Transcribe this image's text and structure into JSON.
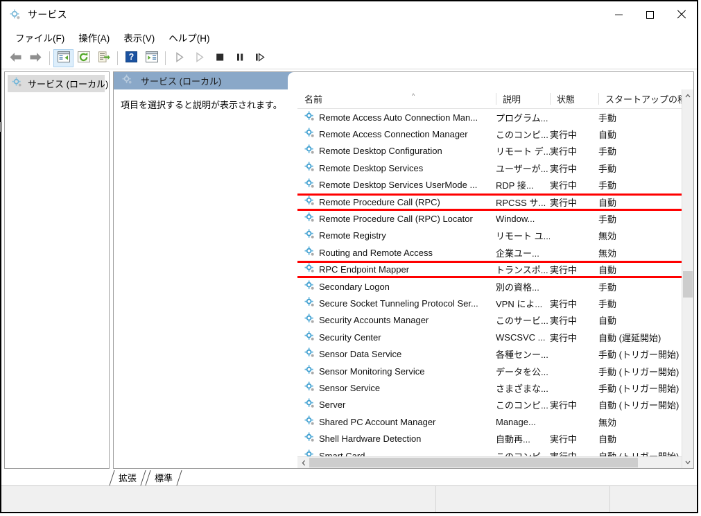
{
  "window": {
    "title": "サービス",
    "title_icon": "services-gear-icon",
    "controls": {
      "minimize": "minimize-button",
      "maximize": "maximize-button",
      "close": "close-button"
    }
  },
  "menubar": {
    "items": [
      {
        "label": "ファイル(F)",
        "name": "menu-file"
      },
      {
        "label": "操作(A)",
        "name": "menu-action"
      },
      {
        "label": "表示(V)",
        "name": "menu-view"
      },
      {
        "label": "ヘルプ(H)",
        "name": "menu-help"
      }
    ]
  },
  "toolbar": {
    "buttons": [
      {
        "name": "back-button",
        "icon": "arrow-left-icon",
        "enabled": true
      },
      {
        "name": "forward-button",
        "icon": "arrow-right-icon",
        "enabled": true
      },
      {
        "name": "show-hide-tree-button",
        "icon": "console-tree-icon",
        "active": true
      },
      {
        "name": "refresh-button",
        "icon": "refresh-icon",
        "enabled": true
      },
      {
        "name": "export-list-button",
        "icon": "export-list-icon",
        "enabled": true
      },
      {
        "name": "help-button",
        "icon": "question-mark-icon",
        "enabled": true
      },
      {
        "name": "show-action-pane-button",
        "icon": "action-pane-icon",
        "enabled": true
      },
      {
        "name": "start-service-button",
        "icon": "play-icon",
        "enabled": false
      },
      {
        "name": "restart-service-button",
        "icon": "play-outline-icon",
        "enabled": false
      },
      {
        "name": "stop-service-button",
        "icon": "stop-square-icon",
        "enabled": true
      },
      {
        "name": "pause-service-button",
        "icon": "pause-icon",
        "enabled": true
      },
      {
        "name": "resume-service-button",
        "icon": "step-forward-icon",
        "enabled": true
      }
    ]
  },
  "tree": {
    "node_label": "サービス (ローカル)",
    "node_icon": "services-gear-icon"
  },
  "pane": {
    "header_label": "サービス (ローカル)",
    "header_icon": "services-gear-icon",
    "header_color": "#8aa8c8",
    "description_placeholder": "項目を選択すると説明が表示されます。"
  },
  "list": {
    "columns": [
      {
        "label": "名前",
        "name": "column-header-name",
        "sorted": true
      },
      {
        "label": "説明",
        "name": "column-header-description",
        "sorted": false
      },
      {
        "label": "状態",
        "name": "column-header-status",
        "sorted": false
      },
      {
        "label": "スタートアップの種類",
        "name": "column-header-startup-type",
        "sorted": true
      }
    ],
    "rows": [
      {
        "name": "Remote Access Auto Connection Man...",
        "description": "プログラム...",
        "status": "",
        "startup": "手動",
        "highlighted": false
      },
      {
        "name": "Remote Access Connection Manager",
        "description": "このコンピ...",
        "status": "実行中",
        "startup": "自動",
        "highlighted": false
      },
      {
        "name": "Remote Desktop Configuration",
        "description": "リモート デ...",
        "status": "実行中",
        "startup": "手動",
        "highlighted": false
      },
      {
        "name": "Remote Desktop Services",
        "description": "ユーザーが...",
        "status": "実行中",
        "startup": "手動",
        "highlighted": false
      },
      {
        "name": "Remote Desktop Services UserMode ...",
        "description": "RDP 接...",
        "status": "実行中",
        "startup": "手動",
        "highlighted": false
      },
      {
        "name": "Remote Procedure Call (RPC)",
        "description": "RPCSS サ...",
        "status": "実行中",
        "startup": "自動",
        "highlighted": true
      },
      {
        "name": "Remote Procedure Call (RPC) Locator",
        "description": "Window...",
        "status": "",
        "startup": "手動",
        "highlighted": false
      },
      {
        "name": "Remote Registry",
        "description": "リモート ユ...",
        "status": "",
        "startup": "無効",
        "highlighted": false
      },
      {
        "name": "Routing and Remote Access",
        "description": "企業ユー...",
        "status": "",
        "startup": "無効",
        "highlighted": false
      },
      {
        "name": "RPC Endpoint Mapper",
        "description": "トランスポ...",
        "status": "実行中",
        "startup": "自動",
        "highlighted": true
      },
      {
        "name": "Secondary Logon",
        "description": "別の資格...",
        "status": "",
        "startup": "手動",
        "highlighted": false
      },
      {
        "name": "Secure Socket Tunneling Protocol Ser...",
        "description": "VPN によ...",
        "status": "実行中",
        "startup": "手動",
        "highlighted": false
      },
      {
        "name": "Security Accounts Manager",
        "description": "このサービ...",
        "status": "実行中",
        "startup": "自動",
        "highlighted": false
      },
      {
        "name": "Security Center",
        "description": "WSCSVC ...",
        "status": "実行中",
        "startup": "自動 (遅延開始)",
        "highlighted": false
      },
      {
        "name": "Sensor Data Service",
        "description": "各種センー...",
        "status": "",
        "startup": "手動 (トリガー開始)",
        "highlighted": false
      },
      {
        "name": "Sensor Monitoring Service",
        "description": "データを公...",
        "status": "",
        "startup": "手動 (トリガー開始)",
        "highlighted": false
      },
      {
        "name": "Sensor Service",
        "description": "さまざまな...",
        "status": "",
        "startup": "手動 (トリガー開始)",
        "highlighted": false
      },
      {
        "name": "Server",
        "description": "このコンピ...",
        "status": "実行中",
        "startup": "自動 (トリガー開始)",
        "highlighted": false
      },
      {
        "name": "Shared PC Account Manager",
        "description": "Manage...",
        "status": "",
        "startup": "無効",
        "highlighted": false
      },
      {
        "name": "Shell Hardware Detection",
        "description": "自動再...",
        "status": "実行中",
        "startup": "自動",
        "highlighted": false
      },
      {
        "name": "Smart Card",
        "description": "このコンピ...",
        "status": "実行中",
        "startup": "自動 (トリガー開始)",
        "highlighted": false
      }
    ],
    "row_icon": "service-gear-icon",
    "highlight_color": "#ff0000"
  },
  "scrollbars": {
    "vertical_up": "▲",
    "vertical_down": "▼",
    "horizontal_left": "‹",
    "horizontal_right": "›"
  },
  "tabs": [
    {
      "label": "拡張",
      "name": "tab-extended"
    },
    {
      "label": "標準",
      "name": "tab-standard"
    }
  ],
  "statusbar": {
    "panel1": "",
    "panel2": "",
    "panel3": ""
  }
}
